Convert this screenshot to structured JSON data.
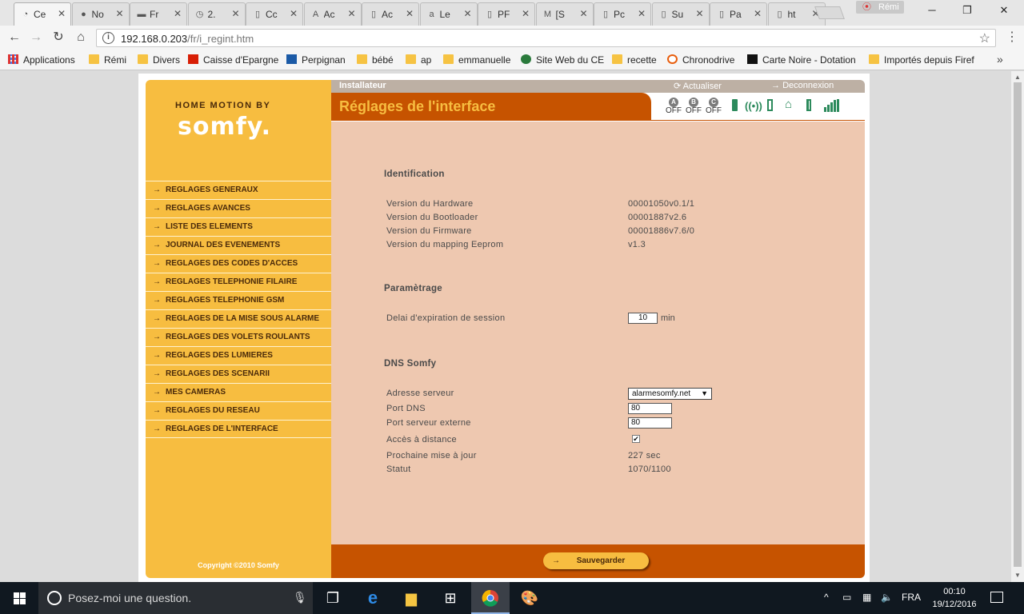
{
  "browser": {
    "tabs": [
      {
        "icon": "document-icon",
        "glyph": "◔",
        "title": "Ce"
      },
      {
        "icon": "yellow-circle-icon",
        "glyph": "●",
        "title": "No"
      },
      {
        "icon": "car-icon",
        "glyph": "▬",
        "title": "Fr"
      },
      {
        "icon": "orange-clock-icon",
        "glyph": "◷",
        "title": "2."
      },
      {
        "icon": "document-icon",
        "glyph": "▯",
        "title": "Cc"
      },
      {
        "icon": "ac-icon",
        "glyph": "A",
        "title": "Ac"
      },
      {
        "icon": "document-icon",
        "glyph": "▯",
        "title": "Ac"
      },
      {
        "icon": "letter-a-icon",
        "glyph": "a",
        "title": "Le"
      },
      {
        "icon": "document-icon",
        "glyph": "▯",
        "title": "PF"
      },
      {
        "icon": "gmail-icon",
        "glyph": "M",
        "title": "[S"
      },
      {
        "icon": "document-icon",
        "glyph": "▯",
        "title": "Pc"
      },
      {
        "icon": "document-icon",
        "glyph": "▯",
        "title": "Su"
      },
      {
        "icon": "document-icon",
        "glyph": "▯",
        "title": "Pa"
      },
      {
        "icon": "document-icon",
        "glyph": "▯",
        "title": "ht"
      }
    ],
    "profile_name": "Rémi",
    "url_host": "192.168.0.203",
    "url_path": "/fr/i_regint.htm",
    "bookmarks": [
      {
        "label": "Applications",
        "icon": "apps-grid-icon"
      },
      {
        "label": "Rémi",
        "icon": "folder-icon"
      },
      {
        "label": "Divers",
        "icon": "folder-icon"
      },
      {
        "label": "Caisse d'Epargne",
        "icon": "caisse-epargne-icon"
      },
      {
        "label": "Perpignan",
        "icon": "perpignan-icon"
      },
      {
        "label": "bébé",
        "icon": "folder-icon"
      },
      {
        "label": "ap",
        "icon": "folder-icon"
      },
      {
        "label": "emmanuelle",
        "icon": "folder-icon"
      },
      {
        "label": "Site Web du CE",
        "icon": "site-ce-icon"
      },
      {
        "label": "recette",
        "icon": "folder-icon"
      },
      {
        "label": "Chronodrive",
        "icon": "chronodrive-icon"
      },
      {
        "label": "Carte Noire - Dotation",
        "icon": "carte-noire-icon"
      },
      {
        "label": "Importés depuis Firef",
        "icon": "folder-icon"
      }
    ]
  },
  "somfy": {
    "brand_top": "HOME MOTION BY",
    "brand_logo": "somfy.",
    "menu": [
      "REGLAGES GENERAUX",
      "REGLAGES AVANCES",
      "LISTE DES ELEMENTS",
      "JOURNAL DES EVENEMENTS",
      "REGLAGES DES CODES D'ACCES",
      "REGLAGES TELEPHONIE FILAIRE",
      "REGLAGES TELEPHONIE GSM",
      "REGLAGES DE LA MISE SOUS ALARME",
      "REGLAGES DES VOLETS ROULANTS",
      "REGLAGES DES LUMIERES",
      "REGLAGES DES SCENARII",
      "MES CAMERAS",
      "REGLAGES DU RESEAU",
      "REGLAGES DE L'INTERFACE"
    ],
    "copyright": "Copyright ©2010 Somfy",
    "topbar": {
      "installateur": "Installateur",
      "actualiser": "Actualiser",
      "deconnexion": "Deconnexion"
    },
    "page_title": "Réglages de l'interface",
    "status": {
      "zones": [
        {
          "letter": "A",
          "state": "OFF"
        },
        {
          "letter": "B",
          "state": "OFF"
        },
        {
          "letter": "C",
          "state": "OFF"
        }
      ]
    },
    "identification": {
      "title": "Identification",
      "rows": [
        {
          "label": "Version du Hardware",
          "value": "00001050v0.1/1"
        },
        {
          "label": "Version du Bootloader",
          "value": "00001887v2.6"
        },
        {
          "label": "Version du Firmware",
          "value": "00001886v7.6/0"
        },
        {
          "label": "Version du mapping Eeprom",
          "value": "v1.3"
        }
      ]
    },
    "parametrage": {
      "title": "Paramètrage",
      "session_label": "Delai d'expiration de session",
      "session_value": "10",
      "session_unit": "min"
    },
    "dns": {
      "title": "DNS Somfy",
      "server_label": "Adresse serveur",
      "server_value": "alarmesomfy.net",
      "port_dns_label": "Port DNS",
      "port_dns_value": "80",
      "port_ext_label": "Port serveur externe",
      "port_ext_value": "80",
      "remote_label": "Accès à distance",
      "remote_checked": true,
      "next_update_label": "Prochaine mise à jour",
      "next_update_value": "227 sec",
      "status_label": "Statut",
      "status_value": "1070/1100"
    },
    "save_label": "Sauvegarder"
  },
  "taskbar": {
    "search_placeholder": "Posez-moi une question.",
    "language": "FRA",
    "time": "00:10",
    "date": "19/12/2016"
  }
}
